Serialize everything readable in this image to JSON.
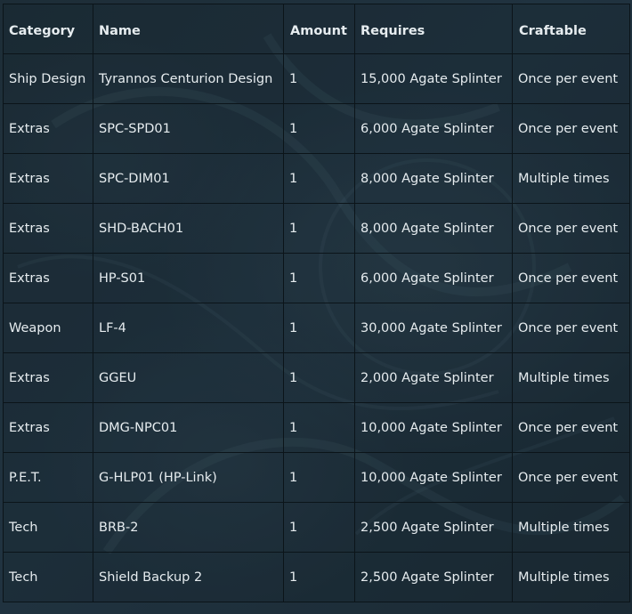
{
  "table": {
    "headers": {
      "category": "Category",
      "name": "Name",
      "amount": "Amount",
      "requires": "Requires",
      "craftable": "Craftable"
    },
    "rows": [
      {
        "category": "Ship Design",
        "name": "Tyrannos Centurion Design",
        "amount": "1",
        "requires": "15,000 Agate Splinter",
        "craftable": "Once per event"
      },
      {
        "category": "Extras",
        "name": "SPC-SPD01",
        "amount": "1",
        "requires": "6,000 Agate Splinter",
        "craftable": "Once per event"
      },
      {
        "category": "Extras",
        "name": "SPC-DIM01",
        "amount": "1",
        "requires": "8,000 Agate Splinter",
        "craftable": "Multiple times"
      },
      {
        "category": "Extras",
        "name": "SHD-BACH01",
        "amount": "1",
        "requires": "8,000 Agate Splinter",
        "craftable": "Once per event"
      },
      {
        "category": "Extras",
        "name": "HP-S01",
        "amount": "1",
        "requires": "6,000 Agate Splinter",
        "craftable": "Once per event"
      },
      {
        "category": "Weapon",
        "name": "LF-4",
        "amount": "1",
        "requires": "30,000 Agate Splinter",
        "craftable": "Once per event"
      },
      {
        "category": "Extras",
        "name": "GGEU",
        "amount": "1",
        "requires": "2,000 Agate Splinter",
        "craftable": "Multiple times"
      },
      {
        "category": "Extras",
        "name": "DMG-NPC01",
        "amount": "1",
        "requires": "10,000 Agate Splinter",
        "craftable": "Once per event"
      },
      {
        "category": "P.E.T.",
        "name": "G-HLP01 (HP-Link)",
        "amount": "1",
        "requires": "10,000 Agate Splinter",
        "craftable": "Once per event"
      },
      {
        "category": "Tech",
        "name": "BRB-2",
        "amount": "1",
        "requires": "2,500 Agate Splinter",
        "craftable": "Multiple times"
      },
      {
        "category": "Tech",
        "name": "Shield Backup 2",
        "amount": "1",
        "requires": "2,500 Agate Splinter",
        "craftable": "Multiple times"
      }
    ]
  }
}
